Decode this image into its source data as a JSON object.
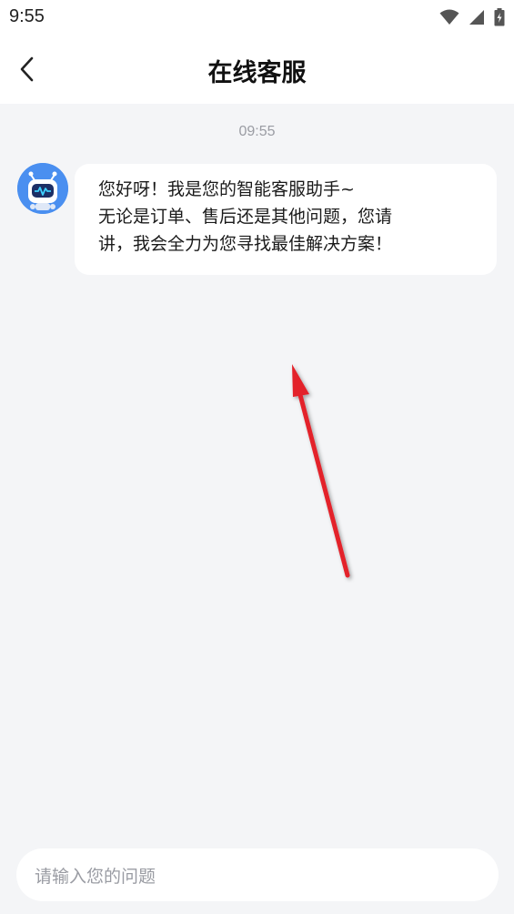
{
  "status_bar": {
    "time": "9:55"
  },
  "header": {
    "title": "在线客服",
    "back_icon": "chevron-left-icon"
  },
  "chat": {
    "timestamp": "09:55",
    "messages": [
      {
        "sender": "bot",
        "avatar_icon": "robot-avatar-icon",
        "lines": [
          "您好呀！我是您的智能客服助手~",
          "无论是订单、售后还是其他问题，您请",
          "讲，我会全力为您寻找最佳解决方案！"
        ]
      }
    ]
  },
  "annotation": {
    "icon": "red-arrow-icon",
    "color": "#e3202a"
  },
  "input": {
    "placeholder": "请输入您的问题"
  }
}
